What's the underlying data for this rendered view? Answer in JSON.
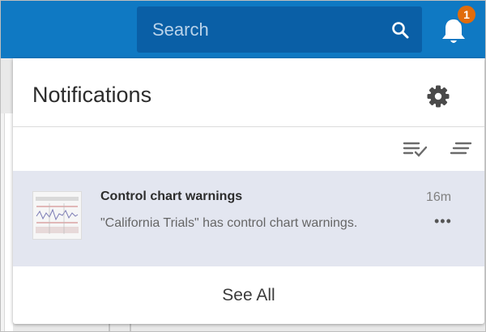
{
  "colors": {
    "topbar": "#0f79c3",
    "search_bg": "#0a5fa6",
    "badge": "#e16c0b",
    "unread_item_bg": "#e3e6f0"
  },
  "header": {
    "search": {
      "placeholder": "Search",
      "icon": "search-icon"
    },
    "notifications_button": {
      "icon": "bell-icon",
      "badge_count": "1"
    }
  },
  "notifications": {
    "title": "Notifications",
    "settings_icon": "gear-icon",
    "toolbar": [
      {
        "icon": "mark-all-read-icon"
      },
      {
        "icon": "sort-lines-icon"
      }
    ],
    "items": [
      {
        "thumbnail": "control-chart-thumbnail",
        "title": "Control chart warnings",
        "message": "\"California Trials\" has control chart warnings.",
        "time": "16m",
        "menu": "•••",
        "unread": true
      }
    ],
    "see_all": "See All"
  }
}
